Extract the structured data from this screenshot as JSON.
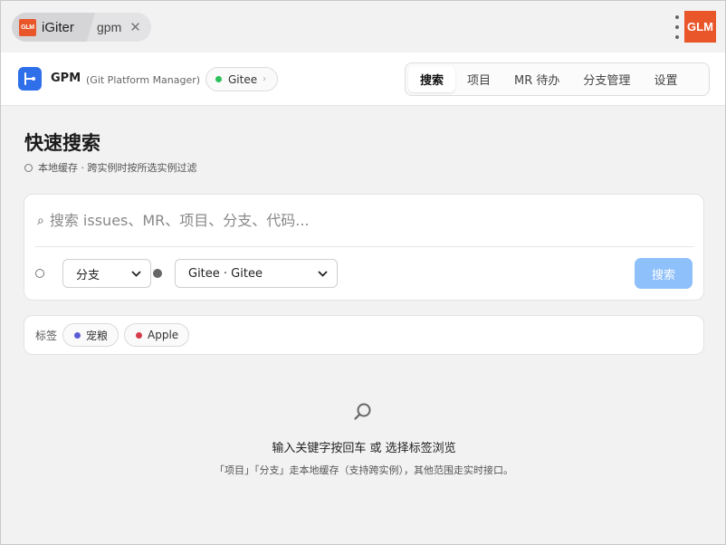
{
  "titlebar": {
    "logo_text": "GLM",
    "app_tab": "iGiter",
    "doc_tab": "gpm",
    "close_glyph": "✕",
    "brand_logo_text": "GLM"
  },
  "header": {
    "app_name": "GPM",
    "app_subtitle": "(Git Platform Manager)",
    "instance": {
      "label": "Gitee",
      "status_color": "#2cc05a"
    },
    "tabs": [
      {
        "label": "搜索",
        "active": true
      },
      {
        "label": "项目",
        "active": false
      },
      {
        "label": "MR 待办",
        "active": false
      },
      {
        "label": "分支管理",
        "active": false
      },
      {
        "label": "设置",
        "active": false
      }
    ]
  },
  "main": {
    "title": "快速搜索",
    "subtitle": "本地缓存 · 跨实例时按所选实例过滤",
    "search": {
      "placeholder": "搜索 issues、MR、项目、分支、代码...",
      "value": "",
      "scope_select": "分支",
      "instance_select": "Gitee · Gitee",
      "button_label": "搜索"
    },
    "tags": {
      "label": "标签",
      "items": [
        {
          "label": "宠粮",
          "color": "#5b5bd6"
        },
        {
          "label": "Apple",
          "color": "#d63b4a"
        }
      ]
    },
    "empty": {
      "title": "输入关键字按回车 或 选择标签浏览",
      "description": "「项目」「分支」走本地缓存（支持跨实例），其他范围走实时接口。"
    }
  },
  "colors": {
    "accent": "#2f6fea",
    "button_disabled": "#8ec0fb",
    "logo_orange": "#e8562a"
  }
}
